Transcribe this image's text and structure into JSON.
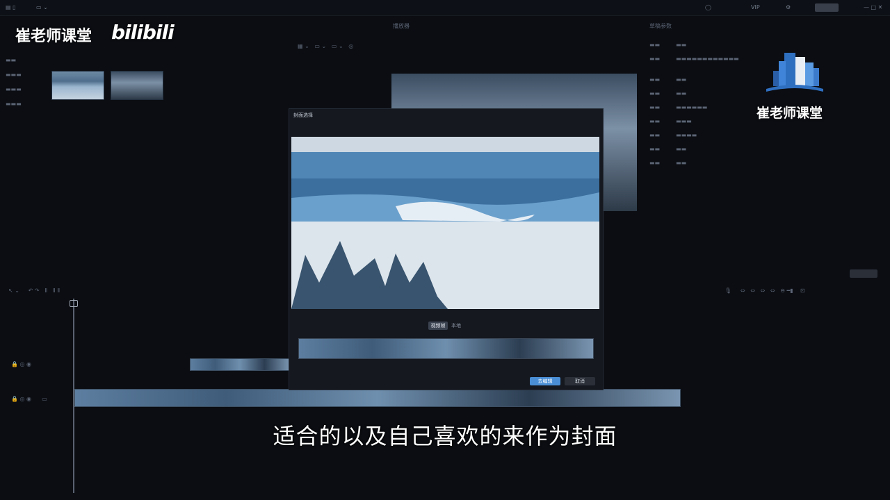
{
  "watermark": {
    "channel": "崔老师课堂",
    "platform": "bilibili",
    "logo_text": "崔老师课堂"
  },
  "dialog": {
    "title": "封面选择",
    "tabs": [
      "视频帧",
      "本地"
    ],
    "confirm_label": "去编辑",
    "cancel_label": "取消"
  },
  "player": {
    "title": "播放器"
  },
  "properties": {
    "title": "草稿参数"
  },
  "subtitle": "适合的以及自己喜欢的来作为封面",
  "colors": {
    "accent": "#4a8fd6",
    "background": "#0b0d12"
  }
}
